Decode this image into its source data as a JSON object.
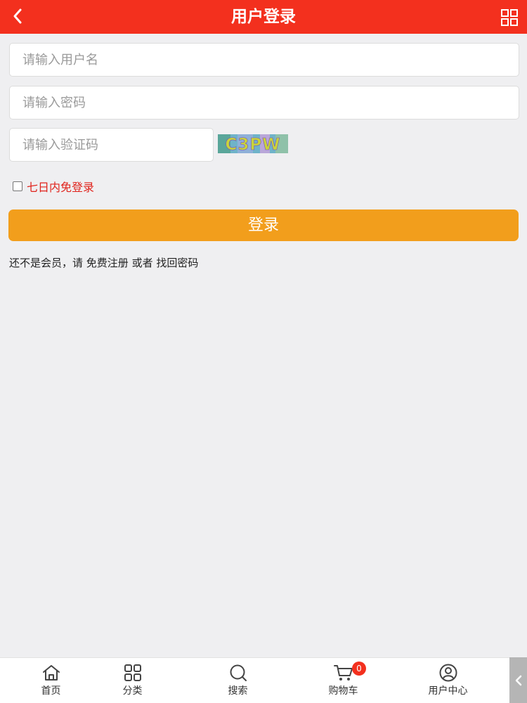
{
  "header": {
    "title": "用户登录",
    "back_icon": "chevron-left-icon",
    "menu_icon": "grid-icon"
  },
  "form": {
    "username_placeholder": "请输入用户名",
    "password_placeholder": "请输入密码",
    "captcha_placeholder": "请输入验证码",
    "captcha_text": "C3PW",
    "remember_label": "七日内免登录",
    "remember_checked": false,
    "login_label": "登录"
  },
  "register": {
    "prefix": "还不是会员，请",
    "register_link": "免费注册",
    "or": "或者",
    "recover_link": "找回密码"
  },
  "footer": {
    "tabs": [
      {
        "label": "首页",
        "icon": "home-icon"
      },
      {
        "label": "分类",
        "icon": "category-grid-icon"
      },
      {
        "label": "搜索",
        "icon": "search-icon"
      },
      {
        "label": "购物车",
        "icon": "cart-icon",
        "badge": "0"
      },
      {
        "label": "用户中心",
        "icon": "user-icon"
      }
    ],
    "side_icon": "chevron-left-icon"
  },
  "colors": {
    "header": "#f3301e",
    "login_button": "#f29e1c",
    "remember_text": "#e0231c",
    "background": "#efeff1"
  }
}
